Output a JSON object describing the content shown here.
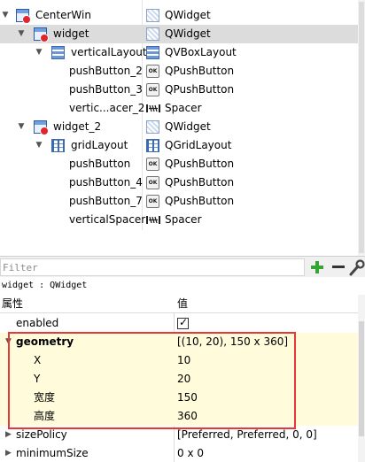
{
  "tree": {
    "rows": [
      {
        "name": "CenterWin",
        "class": "QWidget",
        "icon": "window-icon",
        "class_icon": "widget-icon",
        "expanded": true
      },
      {
        "name": "widget",
        "class": "QWidget",
        "icon": "window-icon",
        "class_icon": "widget-icon",
        "expanded": true,
        "selected": true
      },
      {
        "name": "verticalLayout",
        "class": "QVBoxLayout",
        "icon": "vbox-layout-icon",
        "class_icon": "vbox-layout-icon",
        "expanded": true
      },
      {
        "name": "pushButton_2",
        "class": "QPushButton",
        "class_icon": "pushbutton-icon"
      },
      {
        "name": "pushButton_3",
        "class": "QPushButton",
        "class_icon": "pushbutton-icon"
      },
      {
        "name": "vertic...acer_2",
        "class": "Spacer",
        "class_icon": "spacer-icon"
      },
      {
        "name": "widget_2",
        "class": "QWidget",
        "icon": "window-icon",
        "class_icon": "widget-icon",
        "expanded": true
      },
      {
        "name": "gridLayout",
        "class": "QGridLayout",
        "icon": "grid-layout-icon",
        "class_icon": "grid-layout-icon",
        "expanded": true
      },
      {
        "name": "pushButton",
        "class": "QPushButton",
        "class_icon": "pushbutton-icon"
      },
      {
        "name": "pushButton_4",
        "class": "QPushButton",
        "class_icon": "pushbutton-icon"
      },
      {
        "name": "pushButton_7",
        "class": "QPushButton",
        "class_icon": "pushbutton-icon"
      },
      {
        "name": "verticalSpacer",
        "class": "Spacer",
        "class_icon": "spacer-icon"
      }
    ],
    "ok_glyph": "OK"
  },
  "filter": {
    "placeholder": "Filter",
    "add_icon": "plus-icon",
    "remove_icon": "minus-icon",
    "configure_icon": "wrench-icon"
  },
  "object_label": "widget : QWidget",
  "properties": {
    "header_property": "属性",
    "header_value": "值",
    "rows": [
      {
        "name": "enabled",
        "value": "",
        "checked": true
      },
      {
        "name": "geometry",
        "value": "[(10, 20), 150 x 360]",
        "bold": true,
        "expanded": true
      },
      {
        "name": "X",
        "value": "10"
      },
      {
        "name": "Y",
        "value": "20"
      },
      {
        "name": "宽度",
        "value": "150"
      },
      {
        "name": "高度",
        "value": "360"
      },
      {
        "name": "sizePolicy",
        "value": "[Preferred, Preferred, 0, 0]",
        "expanded": false
      },
      {
        "name": "minimumSize",
        "value": "0 x 0",
        "expanded": false
      }
    ]
  },
  "colors": {
    "highlight_box": "#e53935",
    "selected_row": "#dcdcdc",
    "group_row": "#fffbdb"
  }
}
